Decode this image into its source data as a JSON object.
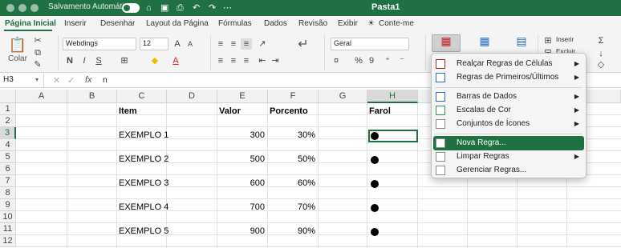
{
  "titlebar": {
    "autosave_label": "Salvamento Automático",
    "doc_title": "Pasta1",
    "icons": [
      "home-icon",
      "save-icon",
      "print-icon",
      "undo-icon",
      "redo-icon",
      "more-icon"
    ]
  },
  "tabs": [
    "Página Inicial",
    "Inserir",
    "Desenhar",
    "Layout da Página",
    "Fórmulas",
    "Dados",
    "Revisão",
    "Exibir"
  ],
  "tell_me": "Conte-me",
  "ribbon": {
    "paste_label": "Colar",
    "font_name": "Webdings",
    "font_size": "12",
    "number_format": "Geral",
    "insert_label": "Inserir",
    "delete_label": "Excluir",
    "bold": "N",
    "italic": "I",
    "underline": "S",
    "percent": "%",
    "thousands": "9"
  },
  "formula_bar": {
    "name_box": "H3",
    "fx": "fx",
    "content": "n"
  },
  "grid": {
    "columns": [
      "A",
      "B",
      "C",
      "D",
      "E",
      "F",
      "G",
      "H",
      "",
      "",
      "L"
    ],
    "rows": [
      "1",
      "2",
      "3",
      "4",
      "5",
      "6",
      "7",
      "8",
      "9",
      "10",
      "11",
      "12"
    ],
    "headers": {
      "item": "Item",
      "valor": "Valor",
      "porcento": "Porcento",
      "farol": "Farol"
    },
    "data": [
      {
        "item": "EXEMPLO 1",
        "valor": "300",
        "porcento": "30%"
      },
      {
        "item": "EXEMPLO 2",
        "valor": "500",
        "porcento": "50%"
      },
      {
        "item": "EXEMPLO 3",
        "valor": "600",
        "porcento": "60%"
      },
      {
        "item": "EXEMPLO 4",
        "valor": "700",
        "porcento": "70%"
      },
      {
        "item": "EXEMPLO 5",
        "valor": "900",
        "porcento": "90%"
      }
    ]
  },
  "cond_format_menu": {
    "items": [
      {
        "label": "Realçar Regras de Células",
        "submenu": true
      },
      {
        "label": "Regras de Primeiros/Últimos",
        "submenu": true
      },
      {
        "label": "Barras de Dados",
        "submenu": true
      },
      {
        "label": "Escalas de Cor",
        "submenu": true
      },
      {
        "label": "Conjuntos de Ícones",
        "submenu": true
      },
      {
        "label": "Nova Regra...",
        "submenu": false,
        "highlighted": true
      },
      {
        "label": "Limpar Regras",
        "submenu": true
      },
      {
        "label": "Gerenciar Regras...",
        "submenu": false
      }
    ]
  },
  "colors": {
    "accent": "#1f7043",
    "font_red": "#e02020",
    "fill_yellow": "#f5e600"
  }
}
